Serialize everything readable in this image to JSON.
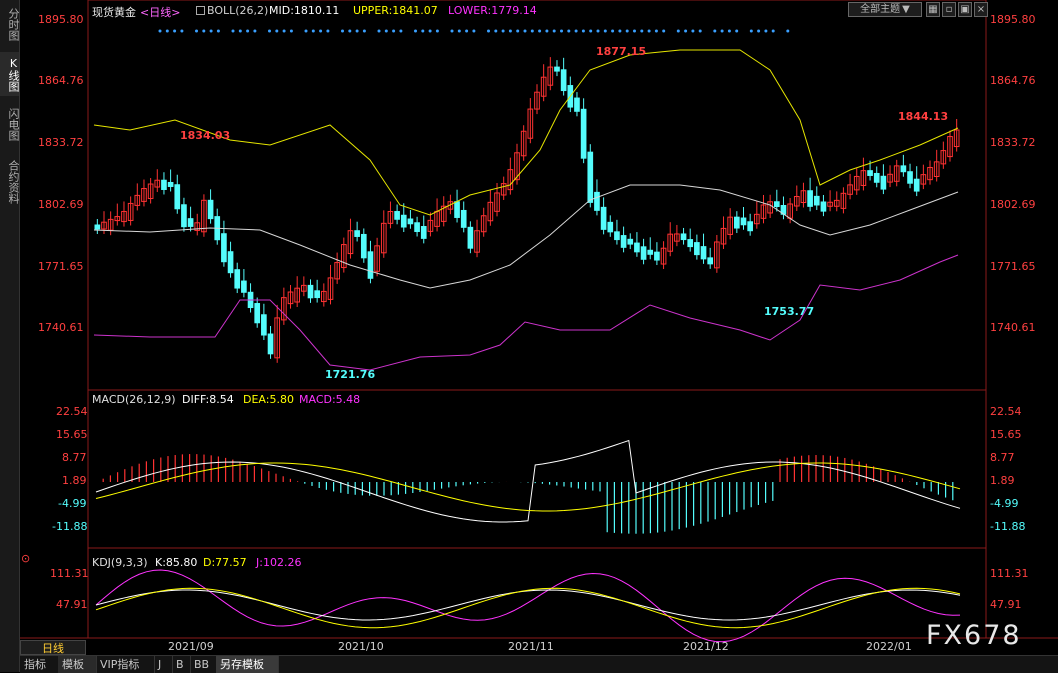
{
  "sidebar": {
    "tabs": [
      {
        "label": "分时图",
        "active": false
      },
      {
        "label": "K线图",
        "active": true
      },
      {
        "label": "闪电图",
        "active": false
      },
      {
        "label": "合约资料",
        "active": false
      }
    ]
  },
  "header": {
    "instrument": "现货黄金",
    "period_tag": "<日线>",
    "boll": "BOLL(26,2)",
    "mid": "MID:1810.11",
    "upper": "UPPER:1841.07",
    "lower": "LOWER:1779.14",
    "theme_button": "全部主题",
    "theme_arrow": "▼"
  },
  "macd_header": {
    "name": "MACD(26,12,9)",
    "diff": "DIFF:8.54",
    "dea": "DEA:5.80",
    "macd": "MACD:5.48"
  },
  "kdj_header": {
    "name": "KDJ(9,3,3)",
    "k": "K:85.80",
    "d": "D:77.57",
    "j": "J:102.26"
  },
  "axes": {
    "price_ticks": [
      "1895.80",
      "1864.76",
      "1833.72",
      "1802.69",
      "1771.65",
      "1740.61"
    ],
    "macd_ticks": [
      "22.54",
      "15.65",
      "8.77",
      "1.89",
      "-4.99",
      "-11.88"
    ],
    "kdj_ticks": [
      "111.31",
      "47.91"
    ],
    "dates": [
      "2021/09",
      "2021/10",
      "2021/11",
      "2021/12",
      "2022/01"
    ]
  },
  "annotations": {
    "a1": "1834.03",
    "a2": "1721.76",
    "a3": "1877.15",
    "a4": "1753.77",
    "a5": "1844.13"
  },
  "bottom": {
    "period": "日线",
    "tabs": [
      "指标",
      "模板",
      "VIP指标",
      "J",
      "B",
      "BB",
      "另存模板"
    ],
    "active_tab": "另存模板"
  },
  "watermark": "FX678",
  "colors": {
    "up": "#ff3232",
    "down": "#54fcfc",
    "price_text": "#ff4040",
    "mid": "#ffffff",
    "upper": "#ffff00",
    "lower": "#ff00ff",
    "boll_mid_line": "#d8d8d8",
    "boll_upper_line": "#e6e600",
    "boll_lower_line": "#cc33cc"
  }
}
